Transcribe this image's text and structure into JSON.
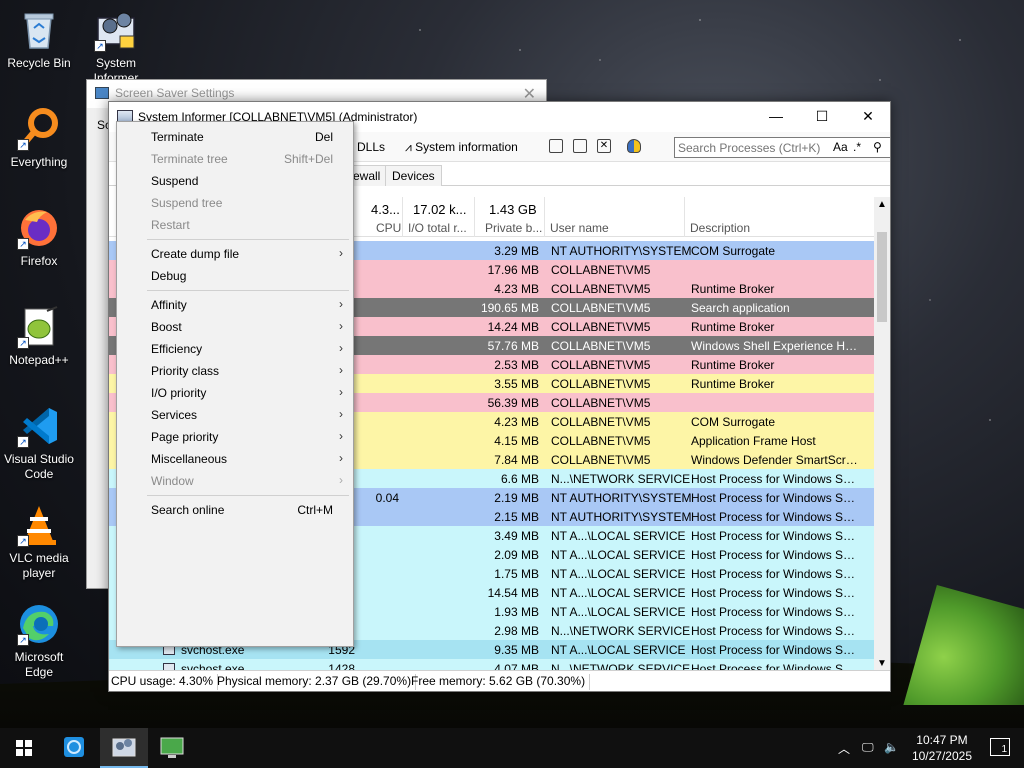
{
  "desktop": {
    "icons": [
      {
        "label": "Recycle Bin"
      },
      {
        "label": "System Informer"
      },
      {
        "label": "Everything"
      },
      {
        "label": "Firefox"
      },
      {
        "label": "Notepad++"
      },
      {
        "label": "Visual Studio Code"
      },
      {
        "label": "VLC media player"
      },
      {
        "label": "Microsoft Edge"
      }
    ]
  },
  "screen_saver_window": {
    "title": "Screen Saver Settings",
    "tab_label": "Sc"
  },
  "main_window": {
    "title": "System Informer [COLLABNET\\VM5] (Administrator)",
    "toolbar": {
      "find_dlls_label": "or DLLs",
      "system_info_label": "System information",
      "search_placeholder": "Search Processes (Ctrl+K)",
      "case_label": "Aa",
      "regex_label": ".*"
    },
    "tabs": [
      "ewall",
      "Devices"
    ],
    "columns": {
      "cpu_total": "4.3...",
      "cpu_label": "CPU",
      "io_total": "17.02 k...",
      "io_label": "I/O total r...",
      "pb_total": "1.43 GB",
      "pb_label": "Private b...",
      "user_label": "User name",
      "desc_label": "Description"
    },
    "rows": [
      {
        "pb": "3.29 MB",
        "user": "NT AUTHORITY\\SYSTEM",
        "desc": "COM Surrogate",
        "color": "#a9c8f5"
      },
      {
        "pb": "17.96 MB",
        "user": "COLLABNET\\VM5",
        "desc": "",
        "color": "#f9c0cc"
      },
      {
        "pb": "4.23 MB",
        "user": "COLLABNET\\VM5",
        "desc": "Runtime Broker",
        "color": "#f9c0cc"
      },
      {
        "pb": "190.65 MB",
        "user": "COLLABNET\\VM5",
        "desc": "Search application",
        "color": "#767676"
      },
      {
        "pb": "14.24 MB",
        "user": "COLLABNET\\VM5",
        "desc": "Runtime Broker",
        "color": "#f9c0cc"
      },
      {
        "pb": "57.76 MB",
        "user": "COLLABNET\\VM5",
        "desc": "Windows Shell Experience Host",
        "color": "#767676"
      },
      {
        "pb": "2.53 MB",
        "user": "COLLABNET\\VM5",
        "desc": "Runtime Broker",
        "color": "#f9c0cc"
      },
      {
        "pb": "3.55 MB",
        "user": "COLLABNET\\VM5",
        "desc": "Runtime Broker",
        "color": "#fdf5a6"
      },
      {
        "pb": "56.39 MB",
        "user": "COLLABNET\\VM5",
        "desc": "",
        "color": "#f9c0cc"
      },
      {
        "pb": "4.23 MB",
        "user": "COLLABNET\\VM5",
        "desc": "COM Surrogate",
        "color": "#fdf5a6"
      },
      {
        "pb": "4.15 MB",
        "user": "COLLABNET\\VM5",
        "desc": "Application Frame Host",
        "color": "#fdf5a6"
      },
      {
        "pb": "7.84 MB",
        "user": "COLLABNET\\VM5",
        "desc": "Windows Defender SmartScre...",
        "color": "#fdf5a6"
      },
      {
        "pb": "6.6 MB",
        "user": "N...\\NETWORK SERVICE",
        "desc": "Host Process for Windows Ser...",
        "color": "#c9f6fb"
      },
      {
        "cpu": "0.04",
        "pb": "2.19 MB",
        "user": "NT AUTHORITY\\SYSTEM",
        "desc": "Host Process for Windows Ser...",
        "color": "#a9c8f5"
      },
      {
        "pb": "2.15 MB",
        "user": "NT AUTHORITY\\SYSTEM",
        "desc": "Host Process for Windows Ser...",
        "color": "#a9c8f5"
      },
      {
        "pb": "3.49 MB",
        "user": "NT A...\\LOCAL SERVICE",
        "desc": "Host Process for Windows Ser...",
        "color": "#c9f6fb"
      },
      {
        "pb": "2.09 MB",
        "user": "NT A...\\LOCAL SERVICE",
        "desc": "Host Process for Windows Ser...",
        "color": "#c9f6fb"
      },
      {
        "pb": "1.75 MB",
        "user": "NT A...\\LOCAL SERVICE",
        "desc": "Host Process for Windows Ser...",
        "color": "#c9f6fb"
      },
      {
        "pb": "14.54 MB",
        "user": "NT A...\\LOCAL SERVICE",
        "desc": "Host Process for Windows Ser...",
        "color": "#c9f6fb"
      },
      {
        "pb": "1.93 MB",
        "user": "NT A...\\LOCAL SERVICE",
        "desc": "Host Process for Windows Ser...",
        "color": "#c9f6fb"
      },
      {
        "pb": "2.98 MB",
        "user": "N...\\NETWORK SERVICE",
        "desc": "Host Process for Windows Ser...",
        "color": "#c9f6fb"
      },
      {
        "proc": "svchost.exe",
        "pid": "1592",
        "pb": "9.35 MB",
        "user": "NT A...\\LOCAL SERVICE",
        "desc": "Host Process for Windows Ser...",
        "color": "#a6e3f2"
      },
      {
        "proc": "svchost.exe",
        "pid": "1428",
        "pb": "4.07 MB",
        "user": "N...\\NETWORK SERVICE",
        "desc": "Host Process for Windows Ser...",
        "color": "#c9f6fb"
      }
    ],
    "status": {
      "cpu": "CPU usage: 4.30%",
      "phys": "Physical memory: 2.37 GB (29.70%)",
      "free": "Free memory: 5.62 GB (70.30%)"
    }
  },
  "context_menu": {
    "items": [
      {
        "label": "Terminate",
        "shortcut": "Del",
        "enabled": true,
        "submenu": false
      },
      {
        "label": "Terminate tree",
        "shortcut": "Shift+Del",
        "enabled": false,
        "submenu": false
      },
      {
        "label": "Suspend",
        "shortcut": "",
        "enabled": true,
        "submenu": false
      },
      {
        "label": "Suspend tree",
        "shortcut": "",
        "enabled": false,
        "submenu": false
      },
      {
        "label": "Restart",
        "shortcut": "",
        "enabled": false,
        "submenu": false,
        "sep_after": true
      },
      {
        "label": "Create dump file",
        "shortcut": "",
        "enabled": true,
        "submenu": true
      },
      {
        "label": "Debug",
        "shortcut": "",
        "enabled": true,
        "submenu": false,
        "sep_after": true
      },
      {
        "label": "Affinity",
        "shortcut": "",
        "enabled": true,
        "submenu": true
      },
      {
        "label": "Boost",
        "shortcut": "",
        "enabled": true,
        "submenu": true
      },
      {
        "label": "Efficiency",
        "shortcut": "",
        "enabled": true,
        "submenu": true
      },
      {
        "label": "Priority class",
        "shortcut": "",
        "enabled": true,
        "submenu": true
      },
      {
        "label": "I/O priority",
        "shortcut": "",
        "enabled": true,
        "submenu": true
      },
      {
        "label": "Services",
        "shortcut": "",
        "enabled": true,
        "submenu": true
      },
      {
        "label": "Page priority",
        "shortcut": "",
        "enabled": true,
        "submenu": true
      },
      {
        "label": "Miscellaneous",
        "shortcut": "",
        "enabled": true,
        "submenu": true
      },
      {
        "label": "Window",
        "shortcut": "",
        "enabled": false,
        "submenu": true,
        "sep_after": true
      },
      {
        "label": "Search online",
        "shortcut": "Ctrl+M",
        "enabled": true,
        "submenu": false
      }
    ]
  },
  "taskbar": {
    "time": "10:47 PM",
    "date": "10/27/2025",
    "notification_count": "1"
  }
}
